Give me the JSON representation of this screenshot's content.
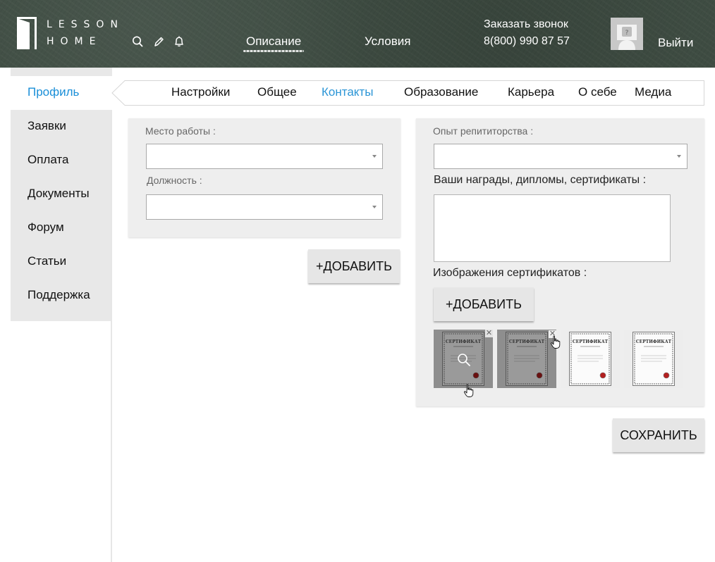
{
  "header": {
    "logo_line1": "LESSON",
    "logo_line2": "HOME",
    "icons": [
      "search-icon",
      "pencil-icon",
      "bell-icon"
    ],
    "nav": [
      {
        "label": "Описание"
      },
      {
        "label": "Условия"
      }
    ],
    "callback_label": "Заказать звонок",
    "phone": "8(800) 990 87 57",
    "avatar_icon": "user-placeholder-icon",
    "logout_label": "Выйти"
  },
  "sidebar": {
    "items": [
      {
        "label": "Профиль",
        "active": true
      },
      {
        "label": "Заявки"
      },
      {
        "label": "Оплата"
      },
      {
        "label": "Документы"
      },
      {
        "label": "Форум"
      },
      {
        "label": "Статьи"
      },
      {
        "label": "Поддержка"
      }
    ]
  },
  "tabs": [
    {
      "label": "Настройки"
    },
    {
      "label": "Общее"
    },
    {
      "label": "Контакты",
      "active": true
    },
    {
      "label": "Образование"
    },
    {
      "label": "Карьера"
    },
    {
      "label": "О себе"
    },
    {
      "label": "Медиа"
    }
  ],
  "career": {
    "workplace_label": "Место работы :",
    "workplace_value": "",
    "position_label": "Должность :",
    "position_value": "",
    "add_button": "+ДОБАВИТЬ"
  },
  "tutoring": {
    "experience_label": "Опыт репититорства :",
    "experience_value": "",
    "awards_label": "Ваши награды, дипломы, сертификаты :",
    "awards_value": "",
    "images_label": "Изображения сертификатов :",
    "add_button": "+ДОБАВИТЬ",
    "certificates": [
      {
        "title": "СЕРТИФИКАТ",
        "state": "hover-zoom"
      },
      {
        "title": "СЕРТИФИКАТ",
        "state": "hover-delete"
      },
      {
        "title": "СЕРТИФИКАТ",
        "state": "normal"
      },
      {
        "title": "СЕРТИФИКАТ",
        "state": "normal"
      }
    ]
  },
  "save_button": "СОХРАНИТЬ",
  "colors": {
    "accent": "#2b95d6",
    "header_bg": "#3f4d43",
    "panel_bg": "#eeeeee",
    "sidebar_bg": "#e8e8e8"
  }
}
